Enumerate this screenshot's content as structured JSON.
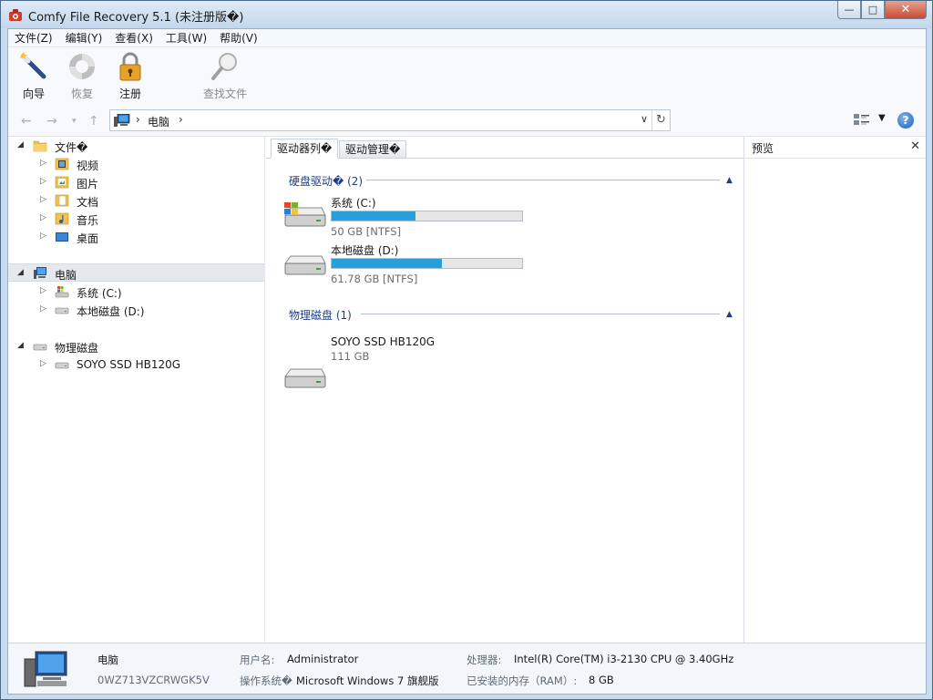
{
  "window": {
    "title": "Comfy File Recovery 5.1 (未注册版�)",
    "controls": {
      "minimize": "—",
      "maximize": "□",
      "close": "✕"
    }
  },
  "menu": [
    "文件(Z)",
    "编辑(Y)",
    "查看(X)",
    "工具(W)",
    "帮助(V)"
  ],
  "toolbar": {
    "wizard": "向导",
    "restore": "恢复",
    "register": "注册",
    "find": "查找文件"
  },
  "address": {
    "sep": "›",
    "crumb": "电脑",
    "nav_back": "←",
    "nav_forward": "→",
    "nav_dropdown": "▾",
    "nav_up": "↑",
    "dropdown": "∨",
    "refresh": "↻",
    "view_dropdown": "▼",
    "help": "?"
  },
  "tree": {
    "expanded_glyph": "◢",
    "collapsed_glyph": "▷",
    "libraries": {
      "label": "文件�",
      "items": [
        "视频",
        "图片",
        "文档",
        "音乐",
        "桌面"
      ]
    },
    "computer": {
      "label": "电脑",
      "items": [
        "系统 (C:)",
        "本地磁盘 (D:)"
      ]
    },
    "physical": {
      "label": "物理磁盘",
      "items": [
        "SOYO SSD HB120G"
      ]
    }
  },
  "tabs": [
    "驱动器列�",
    "驱动管理�"
  ],
  "groups": {
    "caret": "▲",
    "hard_drives": {
      "title": "硬盘驱动� (2)",
      "drives": [
        {
          "name": "系统 (C:)",
          "info": "50 GB [NTFS]",
          "used_fraction": 0.44
        },
        {
          "name": "本地磁盘 (D:)",
          "info": "61.78 GB [NTFS]",
          "used_fraction": 0.58
        }
      ]
    },
    "physical_disks": {
      "title": "物理磁盘 (1)",
      "disks": [
        {
          "name": "SOYO SSD HB120G",
          "info": "111 GB"
        }
      ]
    }
  },
  "preview": {
    "title": "预览",
    "close": "✕"
  },
  "status": {
    "name": "电脑",
    "id": "0WZ713VZCRWGK5V",
    "user_label": "用户名:",
    "user_value": "Administrator",
    "os_label": "操作系统�",
    "os_value": "Microsoft Windows 7 旗舰版",
    "cpu_label": "处理器:",
    "cpu_value": "Intel(R) Core(TM) i3-2130 CPU @ 3.40GHz",
    "ram_label": "已安装的内存（RAM）:",
    "ram_value": "8 GB"
  },
  "colors": {
    "accent": "#26a0da",
    "group_header": "#1e3f86",
    "window_frame": "#c9dcef"
  }
}
